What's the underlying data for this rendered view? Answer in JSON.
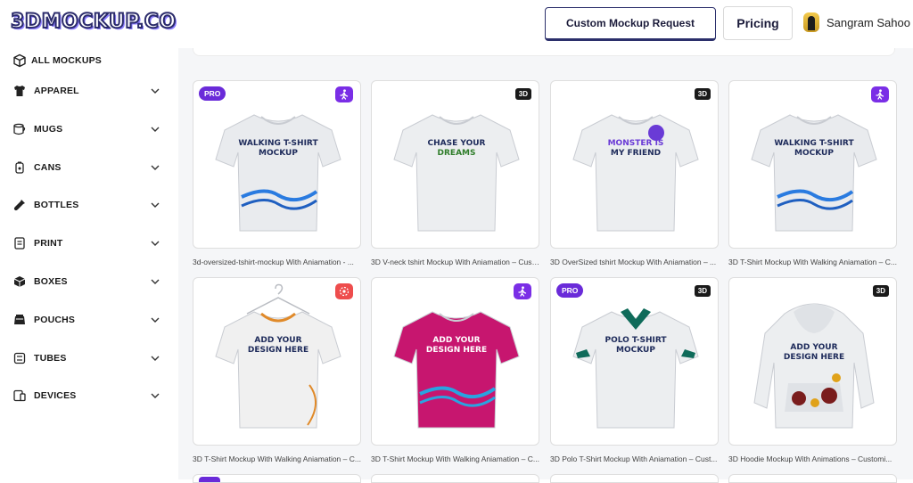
{
  "header": {
    "logo": "3DMOCKUP.CO",
    "custom_request": "Custom Mockup Request",
    "pricing": "Pricing",
    "user_name": "Sangram Sahoo"
  },
  "sidebar": {
    "items": [
      {
        "label": "ALL MOCKUPS",
        "icon": "cube-icon"
      },
      {
        "label": "APPAREL",
        "icon": "tshirt-icon"
      },
      {
        "label": "MUGS",
        "icon": "mug-icon"
      },
      {
        "label": "CANS",
        "icon": "can-icon"
      },
      {
        "label": "BOTTLES",
        "icon": "bottle-icon"
      },
      {
        "label": "PRINT",
        "icon": "print-icon"
      },
      {
        "label": "BOXES",
        "icon": "box-icon"
      },
      {
        "label": "POUCHS",
        "icon": "pouch-icon"
      },
      {
        "label": "TUBES",
        "icon": "tube-icon"
      },
      {
        "label": "DEVICES",
        "icon": "device-icon"
      }
    ]
  },
  "cards": [
    {
      "title": "3d-oversized-tshirt-mockup With Aniamation - ...",
      "badge_left": "PRO",
      "badge_right": "walk",
      "color": "#e9ebee",
      "print_text": "WALKING T-SHIRT MOCKUP"
    },
    {
      "title": "3D V-neck tshirt Mockup With Aniamation – Cust...",
      "badge_right": "3D",
      "color": "#eceef0",
      "print_text": "CHASE YOUR DREAMS"
    },
    {
      "title": "3D OverSized tshirt Mockup With Aniamation – ...",
      "badge_right": "3D",
      "color": "#eceef0",
      "print_text": "MONSTER IS MY FRIEND"
    },
    {
      "title": "3D T-Shirt Mockup With Walking Aniamation – C...",
      "badge_right": "walk",
      "color": "#e9ebee",
      "print_text": "WALKING T-SHIRT MOCKUP"
    },
    {
      "title": "3D T-Shirt Mockup With Walking Aniamation – C...",
      "badge_right": "anim",
      "color": "#f0f0f0",
      "print_text": "ADD YOUR DESIGN HERE"
    },
    {
      "title": "3D T-Shirt Mockup With Walking Aniamation – C...",
      "badge_right": "walk",
      "color": "#c7166f",
      "print_text": "ADD YOUR DESIGN HERE"
    },
    {
      "title": "3D Polo T-Shirt Mockup With Aniamation – Cust...",
      "badge_left": "PRO",
      "badge_right": "3D",
      "color": "#eceef0",
      "print_text": "POLO T-SHIRT MOCKUP"
    },
    {
      "title": "3D Hoodie Mockup With Animations – Customi...",
      "badge_right": "3D",
      "color": "#eceef0",
      "print_text": "ADD YOUR DESIGN HERE"
    }
  ]
}
